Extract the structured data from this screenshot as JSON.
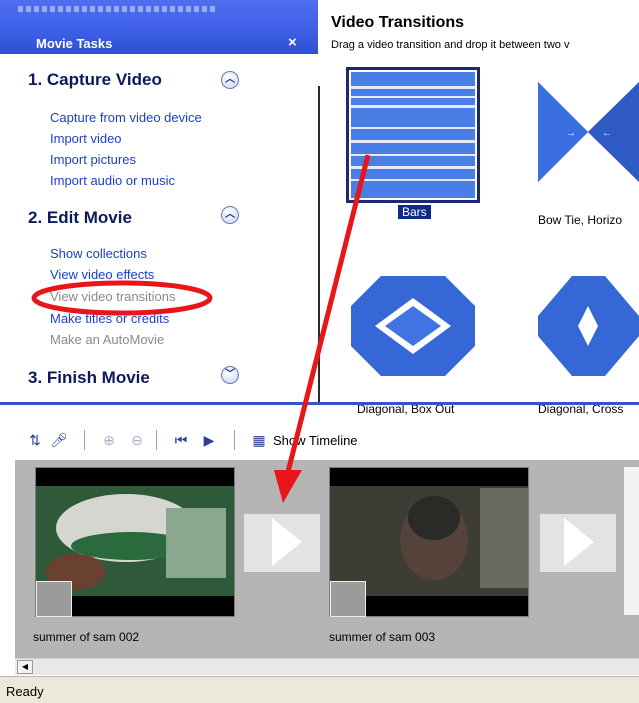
{
  "task_pane": {
    "title": "Movie Tasks",
    "close": "×",
    "sections": [
      {
        "title": "1. Capture Video",
        "toggle": "⌃",
        "tasks": [
          {
            "label": "Capture from video device",
            "enabled": true
          },
          {
            "label": "Import video",
            "enabled": true
          },
          {
            "label": "Import pictures",
            "enabled": true
          },
          {
            "label": "Import audio or music",
            "enabled": true
          }
        ]
      },
      {
        "title": "2. Edit Movie",
        "toggle": "⌃",
        "tasks": [
          {
            "label": "Show collections",
            "enabled": true
          },
          {
            "label": "View video effects",
            "enabled": true
          },
          {
            "label": "View video transitions",
            "enabled": false
          },
          {
            "label": "Make titles or credits",
            "enabled": true
          },
          {
            "label": "Make an AutoMovie",
            "enabled": false
          }
        ]
      },
      {
        "title": "3. Finish Movie",
        "toggle": "⌄",
        "tasks": []
      }
    ]
  },
  "collection": {
    "title": "Video Transitions",
    "description": "Drag a video transition and drop it between two v",
    "items": [
      {
        "label": "Bars",
        "selected": true
      },
      {
        "label": "Bow Tie, Horizo",
        "selected": false
      },
      {
        "label": "Diagonal, Box Out",
        "selected": false
      },
      {
        "label": "Diagonal, Cross",
        "selected": false
      }
    ]
  },
  "toolbar": {
    "show_timeline_label": "Show Timeline"
  },
  "storyboard": {
    "clips": [
      {
        "name": "summer of sam 002"
      },
      {
        "name": "summer of sam 003"
      }
    ]
  },
  "status": {
    "text": "Ready"
  },
  "colors": {
    "header_blue": "#3c5fe5",
    "link_blue": "#1c3fc9",
    "annotation_red": "#e8151b",
    "transition_blue": "#3567d6"
  }
}
